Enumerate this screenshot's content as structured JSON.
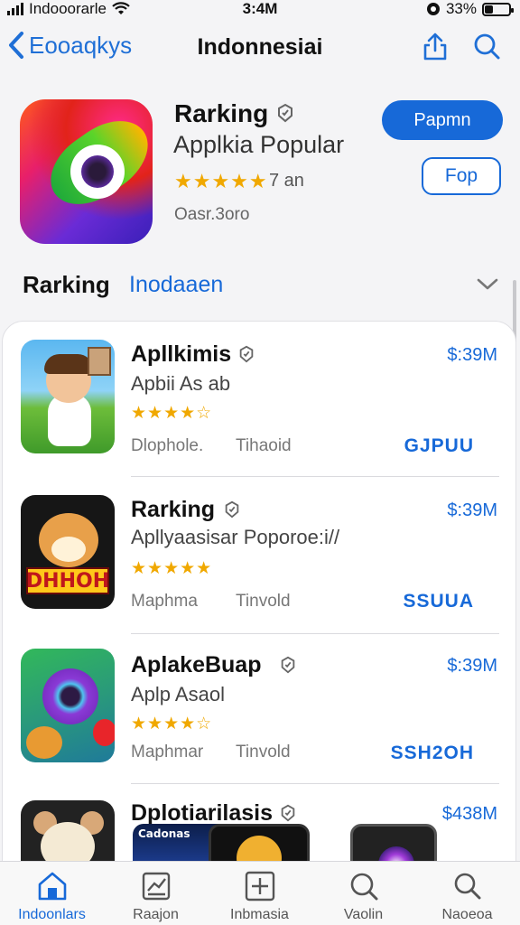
{
  "status_bar": {
    "carrier": "Indooorarle",
    "time": "3:4M",
    "battery": "33%",
    "battery_level": 0.33
  },
  "nav": {
    "back_label": "Eooaqkys",
    "title": "Indonnesiai",
    "share_icon": "share-icon",
    "search_icon": "search-icon"
  },
  "hero": {
    "title": "Rarking",
    "subtitle": "Applkia Popular",
    "stars": "★★★★★",
    "rating_count": "7 an",
    "meta": "Oasr.3oro",
    "primary_button": "Papmn",
    "secondary_button": "Fop",
    "accent": "#1769d8"
  },
  "section": {
    "title": "Rarking",
    "link": "Inodaaen"
  },
  "list": [
    {
      "name": "Apllkimis",
      "subtitle": "Apbii As ab",
      "stars": "★★★★☆",
      "meta1": "Dlophole.",
      "meta2": "Tihaoid",
      "price": "$:39M",
      "action": "GJPUU"
    },
    {
      "name": "Rarking",
      "subtitle": "Apllyaasisar Poporoe:i//",
      "stars": "★★★★★",
      "meta1": "Maphma",
      "meta2": "Tinvold",
      "price": "$:39M",
      "action": "SSUUA",
      "icon_text": "DHHOH"
    },
    {
      "name": "AplakeBuap",
      "subtitle": "Aplp Asaol",
      "stars": "★★★★☆",
      "meta1": "Maphmar",
      "meta2": "Tinvold",
      "price": "$:39M",
      "action": "SSH2OH"
    },
    {
      "name": "Dplotiarilasis",
      "price": "$438M",
      "screenshot_text": "Cadonas"
    }
  ],
  "tabbar": [
    {
      "label": "Indoonlars",
      "icon": "home-icon",
      "active": true
    },
    {
      "label": "Raajon",
      "icon": "chart-icon",
      "active": false
    },
    {
      "label": "Inbmasia",
      "icon": "add-icon",
      "active": false
    },
    {
      "label": "Vaolin",
      "icon": "search-icon",
      "active": false
    },
    {
      "label": "Naoeoa",
      "icon": "search-icon",
      "active": false
    }
  ]
}
